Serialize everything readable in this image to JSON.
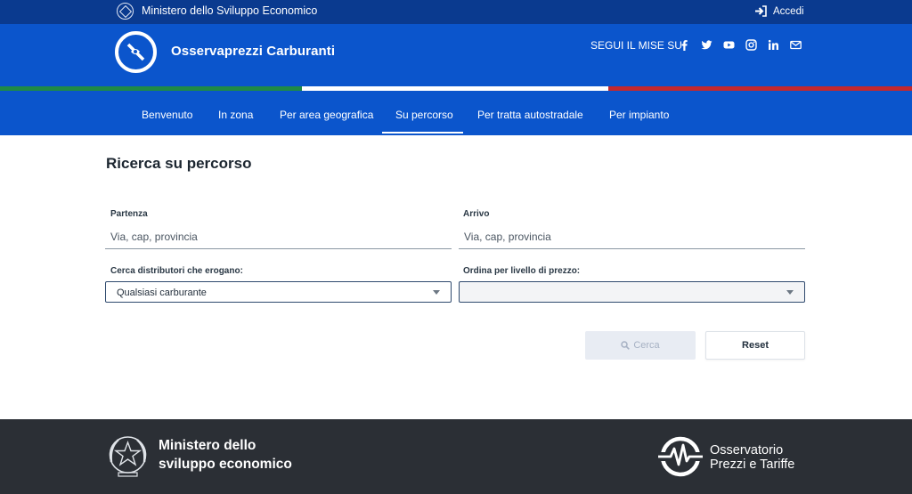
{
  "topbar": {
    "ministry": "Ministero dello Sviluppo Economico",
    "login_label": "Accedi"
  },
  "header": {
    "site_title": "Osservaprezzi Carburanti",
    "social_label": "SEGUI IL MISE SU",
    "social_icons": [
      "facebook-icon",
      "twitter-icon",
      "youtube-icon",
      "instagram-icon",
      "linkedin-icon",
      "mail-icon"
    ]
  },
  "nav": {
    "items": [
      {
        "label": "Benvenuto"
      },
      {
        "label": "In zona"
      },
      {
        "label": "Per area geografica"
      },
      {
        "label": "Su percorso"
      },
      {
        "label": "Per tratta autostradale"
      },
      {
        "label": "Per impianto"
      }
    ],
    "active": "Su percorso"
  },
  "main": {
    "title": "Ricerca su percorso",
    "partenza": {
      "label": "Partenza",
      "placeholder": "Via, cap, provincia",
      "value": ""
    },
    "arrivo": {
      "label": "Arrivo",
      "placeholder": "Via, cap, provincia",
      "value": ""
    },
    "fuel": {
      "label": "Cerca distributori che erogano:",
      "selected": "Qualsiasi carburante"
    },
    "order": {
      "label": "Ordina per livello di prezzo:",
      "selected": ""
    },
    "search_button": "Cerca",
    "reset_button": "Reset"
  },
  "footer": {
    "ministry_line1": "Ministero dello",
    "ministry_line2": "sviluppo economico",
    "observatory_line1": "Osservatorio",
    "observatory_line2": "Prezzi e Tariffe"
  },
  "colors": {
    "topbar": "#0a3a8f",
    "header": "#0b55cc",
    "flag_green": "#1f8a45",
    "flag_white": "#ffffff",
    "flag_red": "#c3282e",
    "footer": "#2b2f35"
  }
}
